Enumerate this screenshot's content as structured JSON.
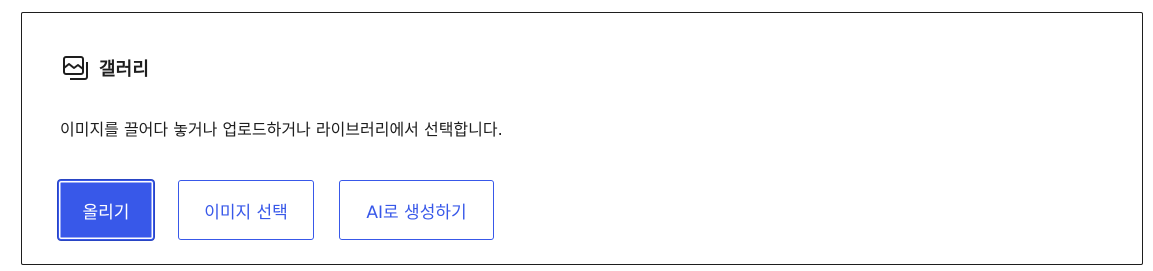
{
  "block": {
    "title": "갤러리",
    "icon": "gallery-icon",
    "instructions": "이미지를 끌어다 놓거나 업로드하거나 라이브러리에서 선택합니다."
  },
  "buttons": {
    "upload_label": "올리기",
    "select_label": "이미지 선택",
    "ai_label": "AI로 생성하기"
  },
  "colors": {
    "accent": "#3858e9",
    "border": "#1e1e1e",
    "text": "#1e1e1e"
  }
}
